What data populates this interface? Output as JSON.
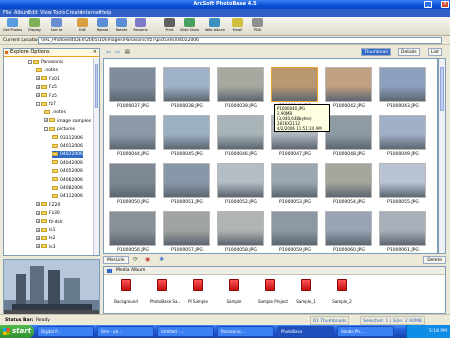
{
  "window": {
    "title": "ArcSoft PhotoBase 4.5"
  },
  "menu": [
    "File",
    "Album",
    "Edit",
    "View",
    "Tools",
    "Create",
    "Internet",
    "Help"
  ],
  "toolbar": [
    {
      "label": "Get Photos",
      "color": "#5a9be0"
    },
    {
      "label": "Display",
      "color": "#7fb05a"
    },
    {
      "label": "Sort to",
      "color": "#6a8fd0"
    },
    {
      "label": "Edit",
      "color": "#d8a040"
    },
    {
      "label": "Rotate",
      "color": "#5a8fd8"
    },
    {
      "label": "Rotate",
      "color": "#5a8fd8"
    },
    {
      "label": "Rename",
      "color": "#7a7ac8"
    },
    {
      "label": "Print",
      "color": "#606060"
    },
    {
      "label": "Slide Show",
      "color": "#4aa060"
    },
    {
      "label": "Web Album",
      "color": "#3a90c0"
    },
    {
      "label": "Email",
      "color": "#d0c040"
    },
    {
      "label": "PDA",
      "color": "#909090"
    }
  ],
  "location": {
    "label": "Current Location:",
    "path": "\\\\HL_Photoedit\\DEV\\2005\\10\\images\\Panasonic\\fz7\\pictures\\04022006"
  },
  "explore": {
    "header": "Explore Options",
    "tree": [
      {
        "label": "Panasonic",
        "indent": 0,
        "expander": "-"
      },
      {
        "label": ".notes",
        "indent": 1,
        "expander": ""
      },
      {
        "label": "Fz01",
        "indent": 1,
        "expander": "+"
      },
      {
        "label": "Fz5",
        "indent": 1,
        "expander": "+"
      },
      {
        "label": "Fz5",
        "indent": 1,
        "expander": "+"
      },
      {
        "label": "fz7",
        "indent": 1,
        "expander": "-"
      },
      {
        "label": ".notes",
        "indent": 2,
        "expander": ""
      },
      {
        "label": "image samples",
        "indent": 2,
        "expander": "+"
      },
      {
        "label": "pictures",
        "indent": 2,
        "expander": "-"
      },
      {
        "label": "03312006",
        "indent": 3,
        "expander": ""
      },
      {
        "label": "04012006",
        "indent": 3,
        "expander": ""
      },
      {
        "label": "04022006",
        "indent": 3,
        "expander": ""
      },
      {
        "label": "04042006",
        "indent": 3,
        "expander": ""
      },
      {
        "label": "04052006",
        "indent": 3,
        "expander": ""
      },
      {
        "label": "04062006",
        "indent": 3,
        "expander": ""
      },
      {
        "label": "04082006",
        "indent": 3,
        "expander": ""
      },
      {
        "label": "04112006",
        "indent": 3,
        "expander": ""
      },
      {
        "label": "FZ20",
        "indent": 1,
        "expander": "+"
      },
      {
        "label": "Fz30",
        "indent": 1,
        "expander": "+"
      },
      {
        "label": "fz-dslr",
        "indent": 1,
        "expander": "+"
      },
      {
        "label": "ls1",
        "indent": 1,
        "expander": "+"
      },
      {
        "label": "ls2",
        "indent": 1,
        "expander": "+"
      },
      {
        "label": "ls3",
        "indent": 1,
        "expander": "+"
      }
    ]
  },
  "views": {
    "thumbnail": "Thumbnail",
    "details": "Details",
    "list": "List"
  },
  "thumbnails": [
    {
      "name": "P1000037.JPG",
      "color": "#7e8c9c"
    },
    {
      "name": "P1000038.JPG",
      "color": "#9fb2c8"
    },
    {
      "name": "P1000039.JPG",
      "color": "#a8a8a0"
    },
    {
      "name": "P1000040.JPG",
      "color": "#b89870"
    },
    {
      "name": "P1000042.JPG",
      "color": "#c0a080"
    },
    {
      "name": "P1000043.JPG",
      "color": "#8aa0bc"
    },
    {
      "name": "P1000044.JPG",
      "color": "#8c9aa8"
    },
    {
      "name": "P1000045.JPG",
      "color": "#9cb0c4"
    },
    {
      "name": "P1000046.JPG",
      "color": "#a8b4b8"
    },
    {
      "name": "P1000047.JPG",
      "color": "#b0b8c0"
    },
    {
      "name": "P1000048.JPG",
      "color": "#8e9aa4"
    },
    {
      "name": "P1000049.JPG",
      "color": "#a0b0c8"
    },
    {
      "name": "P1000050.JPG",
      "color": "#7c8894"
    },
    {
      "name": "P1000051.JPG",
      "color": "#8898a8"
    },
    {
      "name": "P1000052.JPG",
      "color": "#b4bcc4"
    },
    {
      "name": "P1000053.JPG",
      "color": "#9ca8b0"
    },
    {
      "name": "P1000054.JPG",
      "color": "#a4a89c"
    },
    {
      "name": "P1000055.JPG",
      "color": "#b8c4d4"
    },
    {
      "name": "P1000056.JPG",
      "color": "#8a9098"
    },
    {
      "name": "P1000057.JPG",
      "color": "#a0a4a0"
    },
    {
      "name": "P1000058.JPG",
      "color": "#b0b4b4"
    },
    {
      "name": "P1000059.JPG",
      "color": "#8c98a4"
    },
    {
      "name": "P1000060.JPG",
      "color": "#98a4b4"
    },
    {
      "name": "P1000061.JPG",
      "color": "#a8b0bc"
    }
  ],
  "tooltip": [
    "P1000040.JPG",
    "2.90MB (3,040,648bytes)",
    "2816X2112",
    "4/2/2006  11:51:24 AM"
  ],
  "gridbar": {
    "mark": "MarLink",
    "delete": "Delete"
  },
  "media": {
    "header": "Media Album",
    "albums": [
      "Background",
      "PhotoBase Sa...",
      "PI Sample",
      "Sample",
      "Sample Project",
      "Sample_1",
      "Sample_2"
    ]
  },
  "status": {
    "label": "Status Bar:",
    "state": "Ready",
    "count": "61 Thumbnails",
    "selected": "Selected: 1 | Size: 2.90MB"
  },
  "taskbar": {
    "start": "start",
    "tasks": [
      "Digital P...",
      "Stre - ph...",
      "Untitled - ...",
      "Panasonic...",
      "PhotoBase",
      "Adobe Ph..."
    ],
    "active_index": 4,
    "clock": "5:18 PM"
  }
}
